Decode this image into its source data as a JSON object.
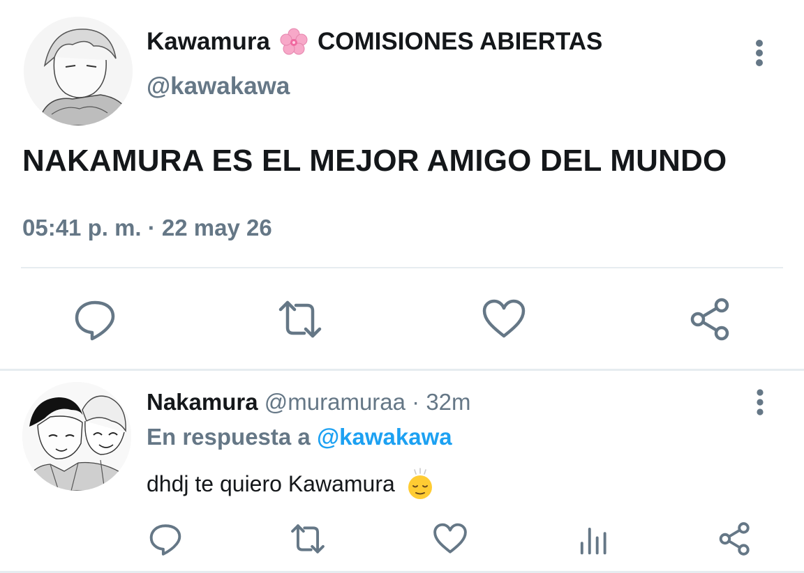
{
  "main_tweet": {
    "author_name": "Kawamura",
    "display_suffix": "COMISIONES ABIERTAS",
    "handle": "@kawakawa",
    "text": "NAKAMURA ES EL MEJOR AMIGO DEL MUNDO",
    "timestamp": "05:41 p. m. · 22 may 26",
    "actions": [
      "reply-icon",
      "retweet-icon",
      "like-icon",
      "share-icon"
    ]
  },
  "reply": {
    "author_name": "Nakamura",
    "handle_time": "@muramuraa · 32m",
    "in_reply_prefix": "En respuesta a",
    "in_reply_handle": "@kawakawa",
    "text": "dhdj te quiero Kawamura",
    "emoji": "relieved-face-emoji",
    "actions": [
      "reply-icon",
      "retweet-icon",
      "like-icon",
      "analytics-icon",
      "share-icon"
    ]
  },
  "colors": {
    "text": "#14171a",
    "secondary": "#657786",
    "link": "#1da1f2",
    "divider": "#e6ecf0"
  }
}
